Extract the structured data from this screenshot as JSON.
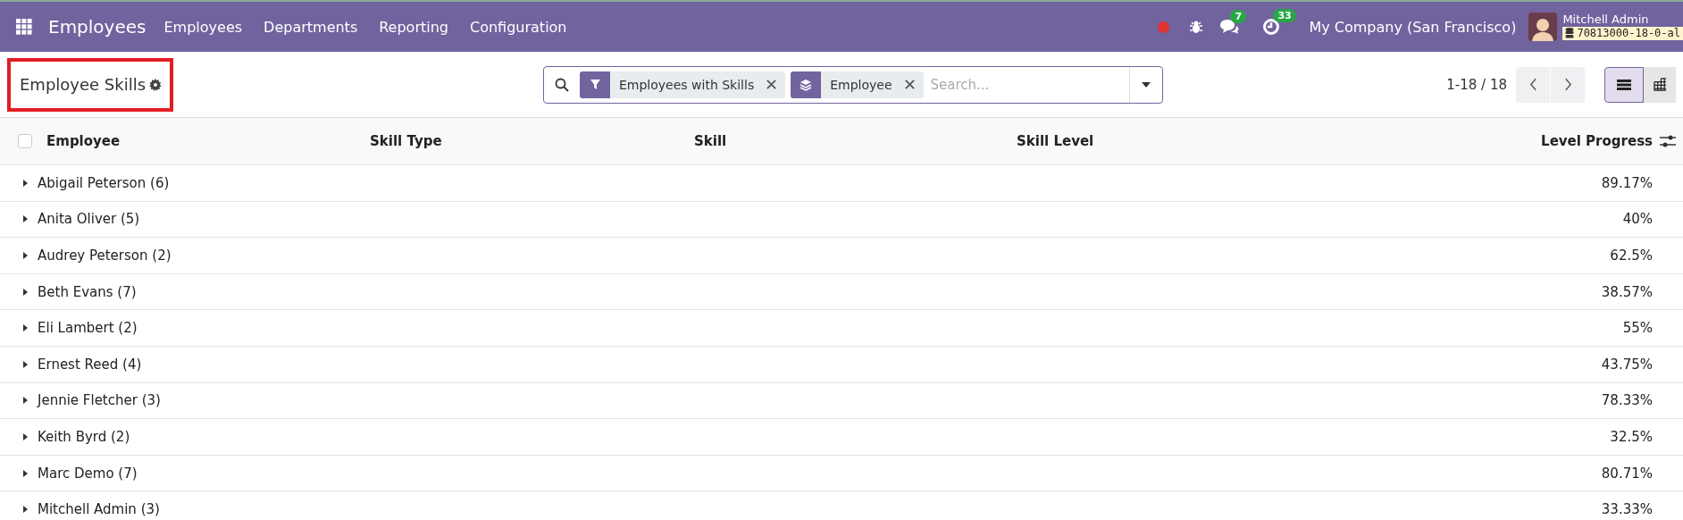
{
  "navbar": {
    "app_title": "Employees",
    "menus": [
      "Employees",
      "Departments",
      "Reporting",
      "Configuration"
    ],
    "messages_count": "7",
    "activities_count": "33",
    "company": "My Company (San Francisco)",
    "user": "Mitchell Admin",
    "database": "70813000-18-0-al"
  },
  "control_panel": {
    "title": "Employee Skills",
    "search": {
      "facets": [
        {
          "kind": "filter",
          "label": "Employees with Skills"
        },
        {
          "kind": "group",
          "label": "Employee"
        }
      ],
      "placeholder": "Search..."
    },
    "pager": "1-18 / 18",
    "views": [
      {
        "kind": "list",
        "selected": true
      },
      {
        "kind": "pivot",
        "selected": false
      }
    ]
  },
  "table": {
    "select_all_checked": false,
    "columns": [
      "Employee",
      "Skill Type",
      "Skill",
      "Skill Level",
      "Level Progress"
    ],
    "rows": [
      {
        "group": "Abigail Peterson (6)",
        "level_progress": "89.17%",
        "expanded": false
      },
      {
        "group": "Anita Oliver (5)",
        "level_progress": "40%",
        "expanded": false
      },
      {
        "group": "Audrey Peterson (2)",
        "level_progress": "62.5%",
        "expanded": false
      },
      {
        "group": "Beth Evans (7)",
        "level_progress": "38.57%",
        "expanded": false
      },
      {
        "group": "Eli Lambert (2)",
        "level_progress": "55%",
        "expanded": false
      },
      {
        "group": "Ernest Reed (4)",
        "level_progress": "43.75%",
        "expanded": false
      },
      {
        "group": "Jennie Fletcher (3)",
        "level_progress": "78.33%",
        "expanded": false
      },
      {
        "group": "Keith Byrd (2)",
        "level_progress": "32.5%",
        "expanded": false
      },
      {
        "group": "Marc Demo (7)",
        "level_progress": "80.71%",
        "expanded": false
      },
      {
        "group": "Mitchell Admin (3)",
        "level_progress": "33.33%",
        "expanded": false
      }
    ]
  }
}
